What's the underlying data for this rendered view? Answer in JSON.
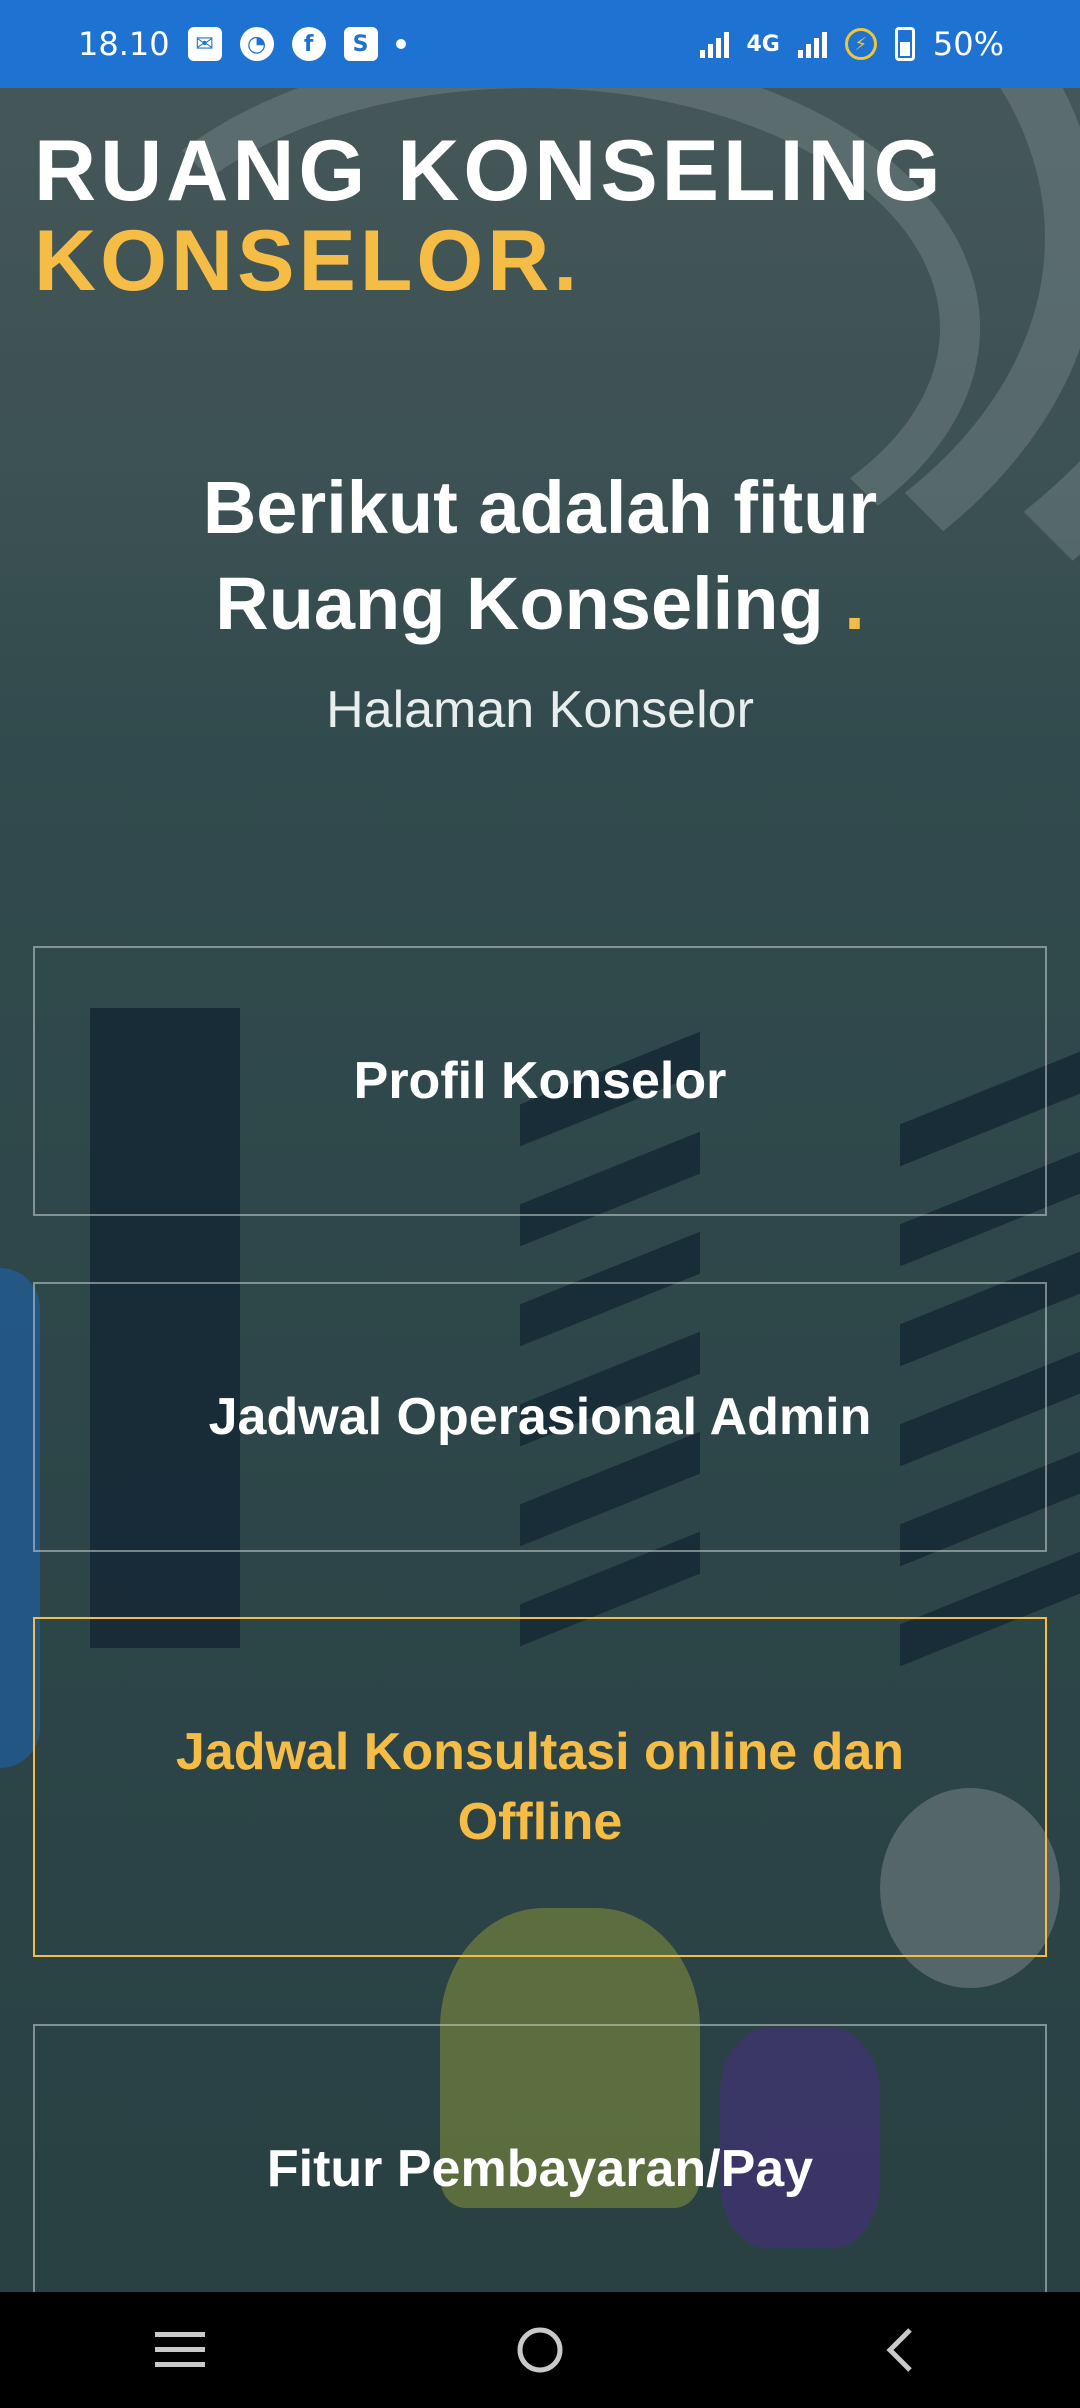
{
  "status_bar": {
    "time": "18.10",
    "network": "4G",
    "battery": "50%",
    "icons": [
      "mail-icon",
      "speed-icon",
      "facebook-icon",
      "shop-icon",
      "dot-icon",
      "signal-icon",
      "battery-saver-icon",
      "battery-icon"
    ]
  },
  "brand": {
    "line1": "RUANG KONSELING",
    "line2": "KONSELOR."
  },
  "headline": {
    "line1": "Berikut adalah fitur",
    "line2": "Ruang Konseling",
    "dot": ".",
    "subtitle": "Halaman Konselor"
  },
  "menu": [
    {
      "label": "Profil Konselor"
    },
    {
      "label": "Jadwal Operasional Admin"
    },
    {
      "label": "Jadwal Konsultasi online dan Offline"
    },
    {
      "label": "Fitur Pembayaran/Pay"
    }
  ],
  "nav_bar": {
    "icons": [
      "recent-apps-icon",
      "home-icon",
      "back-icon"
    ]
  },
  "colors": {
    "status_bar": "#1e73d2",
    "accent": "#f5bd46",
    "nav_bar": "#000000"
  }
}
